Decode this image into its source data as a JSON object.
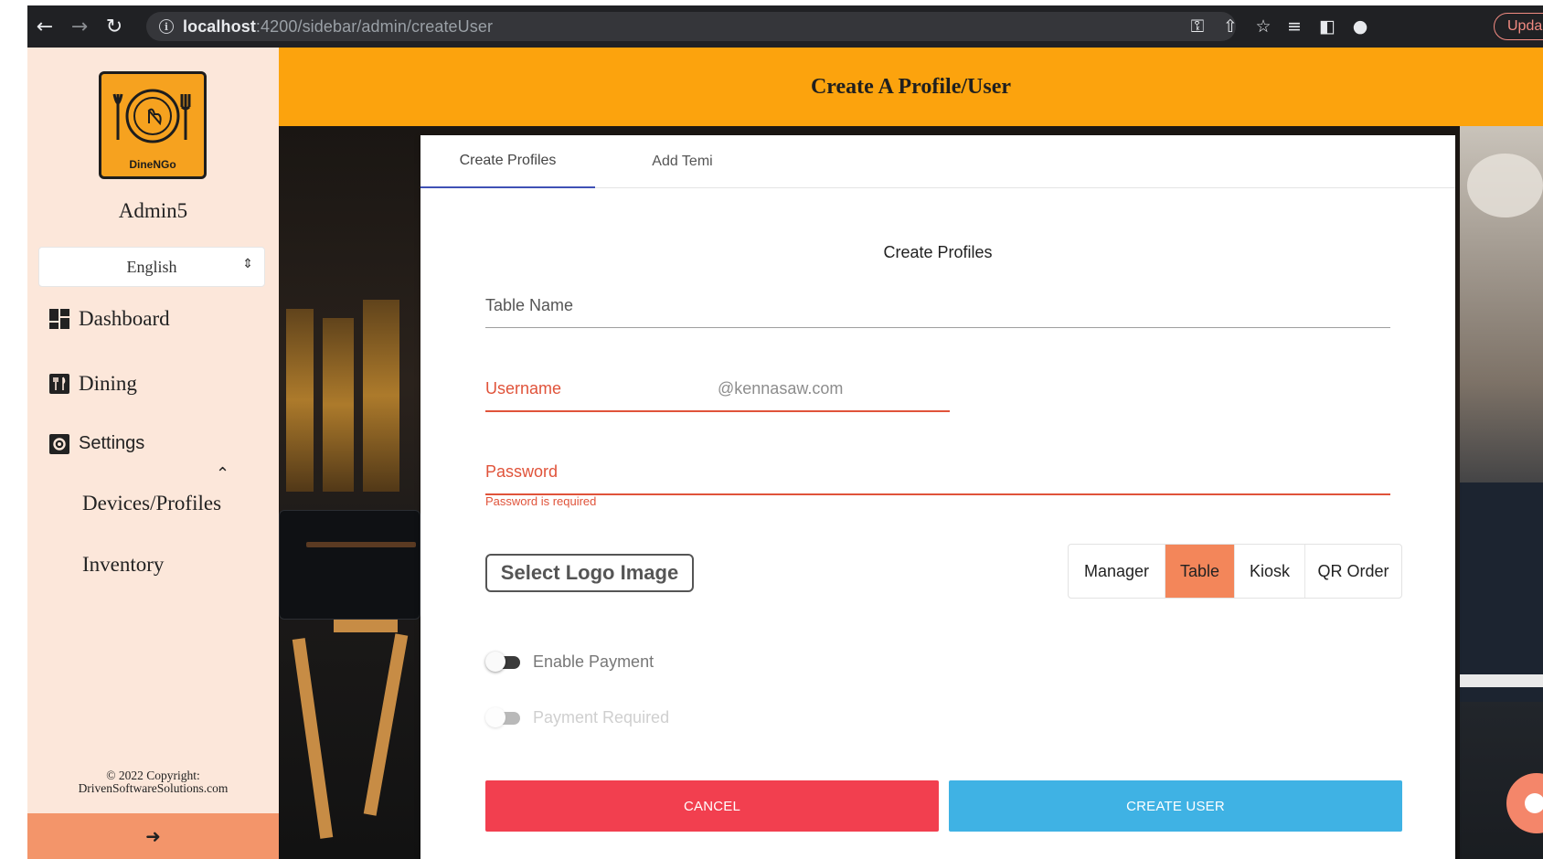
{
  "browser": {
    "url_host": "localhost",
    "url_path": ":4200/sidebar/admin/createUser",
    "update_label": "Upda"
  },
  "sidebar": {
    "logo_text": "DineNGo",
    "admin_name": "Admin5",
    "language": "English",
    "items": [
      {
        "label": "Dashboard",
        "icon": "dashboard-icon"
      },
      {
        "label": "Dining",
        "icon": "dining-icon"
      },
      {
        "label": "Settings",
        "icon": "settings-icon"
      }
    ],
    "sub_items": [
      "Devices/Profiles",
      "Inventory"
    ],
    "copyright_line1": "© 2022 Copyright:",
    "copyright_line2": "DrivenSoftwareSolutions.com"
  },
  "header": {
    "title": "Create A Profile/User"
  },
  "card": {
    "tabs": [
      "Create Profiles",
      "Add Temi"
    ],
    "active_tab": 0,
    "form_title": "Create Profiles",
    "fields": {
      "table_name": {
        "label": "Table Name",
        "value": ""
      },
      "username": {
        "label": "Username",
        "suffix": "@kennasaw.com",
        "value": ""
      },
      "password": {
        "label": "Password",
        "value": "",
        "error": "Password is required"
      }
    },
    "logo_button": "Select Logo Image",
    "roles": [
      "Manager",
      "Table",
      "Kiosk",
      "QR Order"
    ],
    "selected_role": "Table",
    "toggles": [
      {
        "label": "Enable Payment",
        "on": false,
        "disabled": false
      },
      {
        "label": "Payment Required",
        "on": false,
        "disabled": true
      }
    ],
    "cancel_label": "CANCEL",
    "create_label": "CREATE USER"
  },
  "colors": {
    "header": "#fca30d",
    "sidebar": "#fce7da",
    "selected_role": "#f3865a",
    "cancel": "#f23f4f",
    "create": "#3fb2e4",
    "error": "#e0533a"
  }
}
